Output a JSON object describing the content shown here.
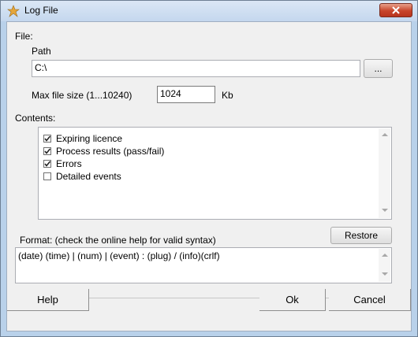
{
  "window": {
    "title": "Log File",
    "icon": "log-file-icon"
  },
  "file": {
    "group_label": "File:",
    "path_label": "Path",
    "path_value": "C:\\",
    "browse_label": "...",
    "maxsize_label": "Max file size (1...10240)",
    "maxsize_value": "1024",
    "maxsize_unit": "Kb"
  },
  "contents": {
    "label": "Contents:",
    "items": [
      {
        "label": "Expiring licence",
        "checked": true
      },
      {
        "label": "Process results (pass/fail)",
        "checked": true
      },
      {
        "label": "Errors",
        "checked": true
      },
      {
        "label": "Detailed events",
        "checked": false
      }
    ]
  },
  "format": {
    "label": "Format:  (check the online help for valid syntax)",
    "restore_label": "Restore",
    "value": "(date) (time) | (num) | (event) : (plug) / (info)(crlf)"
  },
  "footer": {
    "help_label": "Help",
    "ok_label": "Ok",
    "cancel_label": "Cancel"
  }
}
